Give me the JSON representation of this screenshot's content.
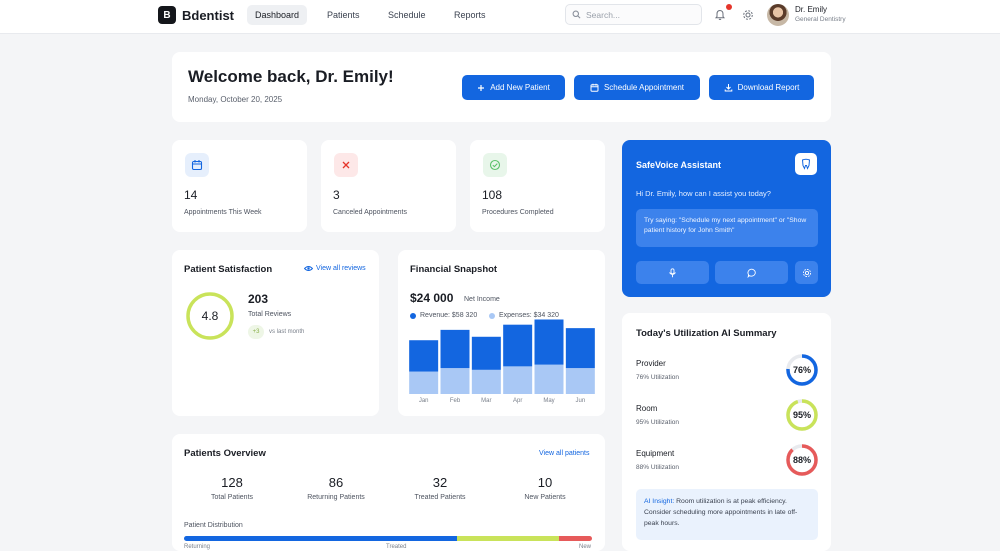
{
  "brand": {
    "logo_letter": "B",
    "name": "Bdentist"
  },
  "nav": {
    "items": [
      "Dashboard",
      "Patients",
      "Schedule",
      "Reports"
    ],
    "active": "Dashboard"
  },
  "search": {
    "placeholder": "Search..."
  },
  "user": {
    "name": "Dr. Emily",
    "role": "General Dentistry"
  },
  "welcome": {
    "title": "Welcome back, Dr. Emily!",
    "date": "Monday, October 20, 2025"
  },
  "actions": {
    "add_patient": "Add New Patient",
    "schedule": "Schedule Appointment",
    "download": "Download Report"
  },
  "stats": [
    {
      "value": "14",
      "label": "Appointments This Week",
      "icon": "calendar-icon",
      "color": "#1366e0"
    },
    {
      "value": "3",
      "label": "Canceled Appointments",
      "icon": "close-icon",
      "color": "#e5352b"
    },
    {
      "value": "108",
      "label": "Procedures Completed",
      "icon": "check-circle-icon",
      "color": "#5cc26a"
    }
  ],
  "satisfaction": {
    "title": "Patient Satisfaction",
    "link": "View all reviews",
    "score": "4.8",
    "reviews_count": "203",
    "reviews_label": "Total Reviews",
    "delta": "+3",
    "delta_label": "vs last month",
    "ring_color": "#c9e35a"
  },
  "financial": {
    "title": "Financial Snapshot",
    "net_income": "$24 000",
    "net_label": "Net Income",
    "revenue_legend": "Revenue: $58 320",
    "expenses_legend": "Expenses: $34 320"
  },
  "chart_data": {
    "type": "bar",
    "categories": [
      "Jan",
      "Feb",
      "Mar",
      "Apr",
      "May",
      "Jun"
    ],
    "series": [
      {
        "name": "Revenue",
        "values": [
          9.5,
          11.5,
          10.0,
          12.5,
          13.5,
          12.0
        ],
        "color": "#1366e0"
      },
      {
        "name": "Expenses",
        "values": [
          6.5,
          7.5,
          7.0,
          8.0,
          8.5,
          7.5
        ],
        "color": "#a9c8f5"
      }
    ]
  },
  "assistant": {
    "title": "SafeVoice Assistant",
    "greeting": "Hi Dr. Emily, how can I assist you today?",
    "hint": "Try saying: \"Schedule my next appointment\" or \"Show patient history for John Smith\""
  },
  "utilization": {
    "title": "Today's Utilization AI Summary",
    "items": [
      {
        "label": "Provider",
        "sub": "76% Utilization",
        "value": "76%",
        "pct": 76,
        "color": "#1366e0"
      },
      {
        "label": "Room",
        "sub": "95% Utilization",
        "value": "95%",
        "pct": 95,
        "color": "#c9e35a"
      },
      {
        "label": "Equipment",
        "sub": "88% Utilization",
        "value": "88%",
        "pct": 88,
        "color": "#e65a5a"
      }
    ],
    "insight_label": "AI Insight:",
    "insight_text": "Room utilization is at peak efficiency. Consider scheduling more appointments in late off-peak hours."
  },
  "overview": {
    "title": "Patients Overview",
    "link": "View all patients",
    "stats": [
      {
        "value": "128",
        "label": "Total Patients"
      },
      {
        "value": "86",
        "label": "Returning Patients"
      },
      {
        "value": "32",
        "label": "Treated Patients"
      },
      {
        "value": "10",
        "label": "New Patients"
      }
    ],
    "distribution_label": "Patient Distribution",
    "segments": [
      {
        "label": "Returning",
        "pct": 67,
        "color": "#1366e0"
      },
      {
        "label": "Treated",
        "pct": 25,
        "color": "#c9e35a"
      },
      {
        "label": "New",
        "pct": 8,
        "color": "#e65a5a"
      }
    ]
  }
}
